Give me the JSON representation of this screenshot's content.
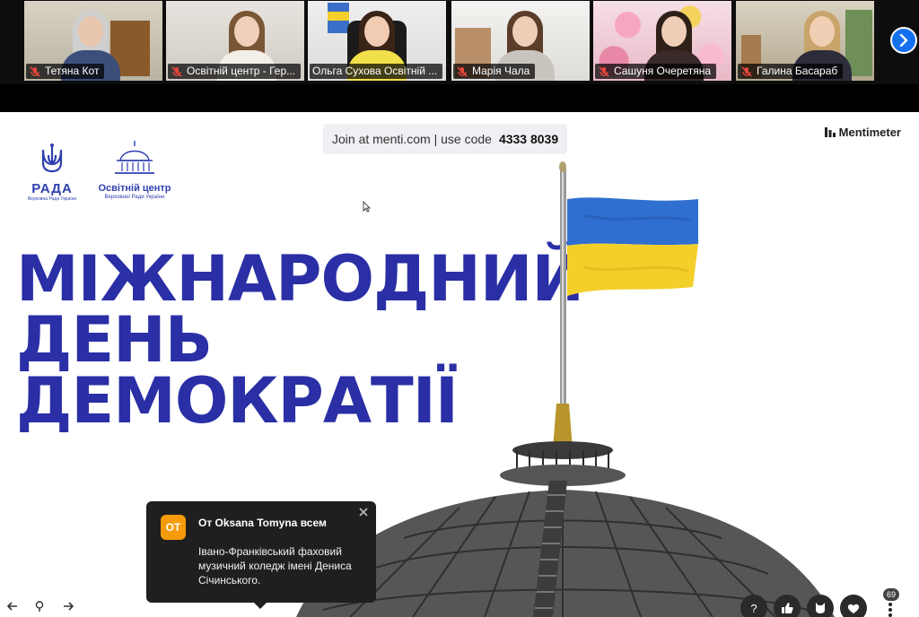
{
  "participants": [
    {
      "name": "Тетяна Кот",
      "muted": true
    },
    {
      "name": "Освітній центр - Гер...",
      "muted": true
    },
    {
      "name": "Ольга Сухова Освітній ...",
      "muted": false,
      "active": true
    },
    {
      "name": "Марія Чала",
      "muted": true
    },
    {
      "name": "Сашуня Очеретяна",
      "muted": true
    },
    {
      "name": "Галина Басараб",
      "muted": true
    }
  ],
  "slide": {
    "join_text": "Join at menti.com | use code",
    "join_code": "4333 8039",
    "brand": "Mentimeter",
    "rada_logo": {
      "word": "РАДА",
      "sub": "Верховна Рада України"
    },
    "osvitniy_logo": {
      "word": "Освітній центр",
      "sub": "Верховної Ради України"
    },
    "headline": [
      "МІЖНАРОДНИЙ",
      "ДЕНЬ",
      "ДЕМОКРАТІЇ"
    ]
  },
  "chat_toast": {
    "avatar_initials": "OT",
    "sender": "От Oksana Tomyna всем",
    "message": "Івано-Франківський фаховий музичний коледж імені Дениса Січинського."
  },
  "reactions": {
    "count": "69"
  },
  "colors": {
    "headline": "#2a2fa6",
    "active_border": "#23d959",
    "flag_blue": "#2f6fd0",
    "flag_yellow": "#f3cf2a",
    "avatar": "#f59b0a"
  }
}
